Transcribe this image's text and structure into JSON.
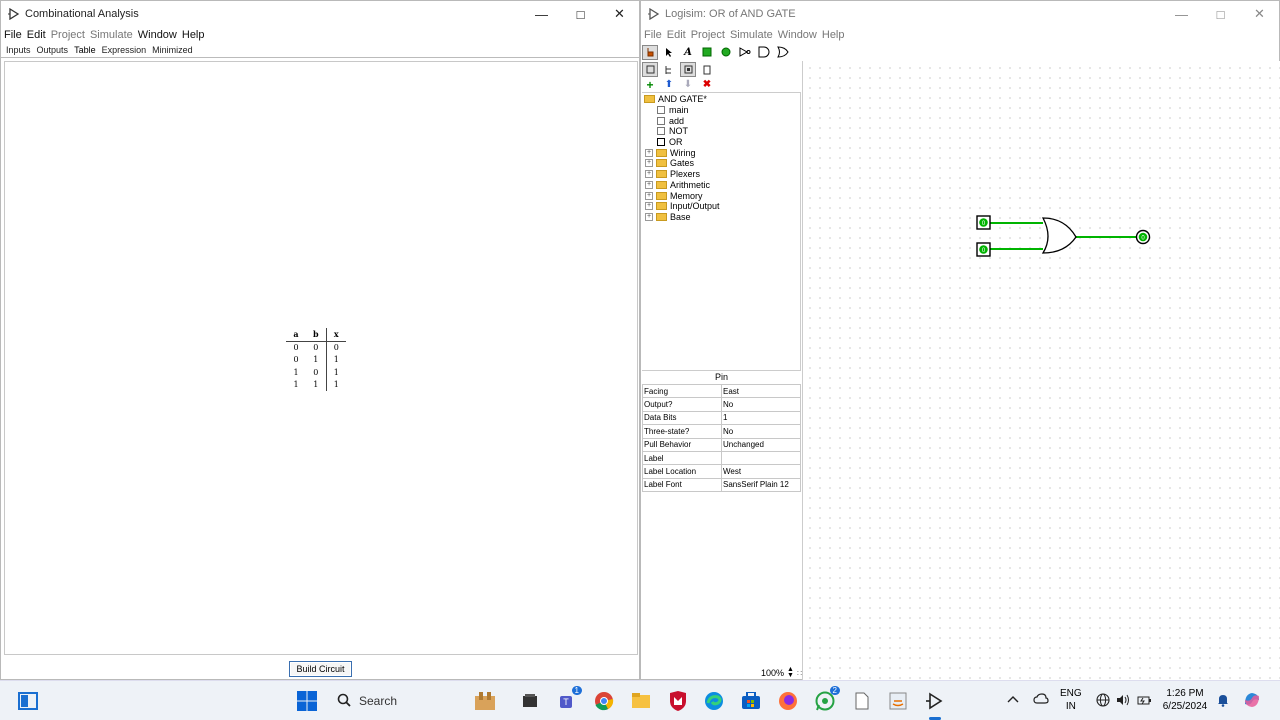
{
  "left_window": {
    "title": "Combinational Analysis",
    "menu": [
      "File",
      "Edit",
      "Project",
      "Simulate",
      "Window",
      "Help"
    ],
    "tabs": [
      "Inputs",
      "Outputs",
      "Table",
      "Expression",
      "Minimized"
    ],
    "active_tab": "Table",
    "truth_table": {
      "headers": [
        "a",
        "b",
        "x"
      ],
      "rows": [
        [
          "0",
          "0",
          "0"
        ],
        [
          "0",
          "1",
          "1"
        ],
        [
          "1",
          "0",
          "1"
        ],
        [
          "1",
          "1",
          "1"
        ]
      ]
    },
    "build_button": "Build Circuit"
  },
  "right_window": {
    "title": "Logisim: OR of AND GATE",
    "menu": [
      "File",
      "Edit",
      "Project",
      "Simulate",
      "Window",
      "Help"
    ],
    "explorer": {
      "project": "AND GATE*",
      "circuits": [
        "main",
        "add",
        "NOT",
        "OR"
      ],
      "libraries": [
        "Wiring",
        "Gates",
        "Plexers",
        "Arithmetic",
        "Memory",
        "Input/Output",
        "Base"
      ]
    },
    "attributes": {
      "title": "Pin",
      "rows": [
        {
          "name": "Facing",
          "value": "East"
        },
        {
          "name": "Output?",
          "value": "No"
        },
        {
          "name": "Data Bits",
          "value": "1"
        },
        {
          "name": "Three-state?",
          "value": "No"
        },
        {
          "name": "Pull Behavior",
          "value": "Unchanged"
        },
        {
          "name": "Label",
          "value": ""
        },
        {
          "name": "Label Location",
          "value": "West"
        },
        {
          "name": "Label Font",
          "value": "SansSerif Plain 12"
        }
      ]
    },
    "zoom": "100%",
    "circuit": {
      "input_a": "0",
      "input_b": "0",
      "output": "0",
      "wire_color": "#00b400"
    }
  },
  "taskbar": {
    "search_placeholder": "Search",
    "teams_badge": "1",
    "whatsapp_badge": "2",
    "language": "ENG",
    "region": "IN",
    "time": "1:26 PM",
    "date": "6/25/2024",
    "icons": [
      "windows-start-icon",
      "search-icon",
      "widgets-icon",
      "terminal-icon",
      "teams-icon",
      "chrome-icon",
      "file-explorer-icon",
      "mcafee-icon",
      "edge-icon",
      "store-icon",
      "firefox-icon",
      "whatsapp-icon",
      "notepad-icon",
      "java-icon",
      "logisim-icon"
    ]
  }
}
